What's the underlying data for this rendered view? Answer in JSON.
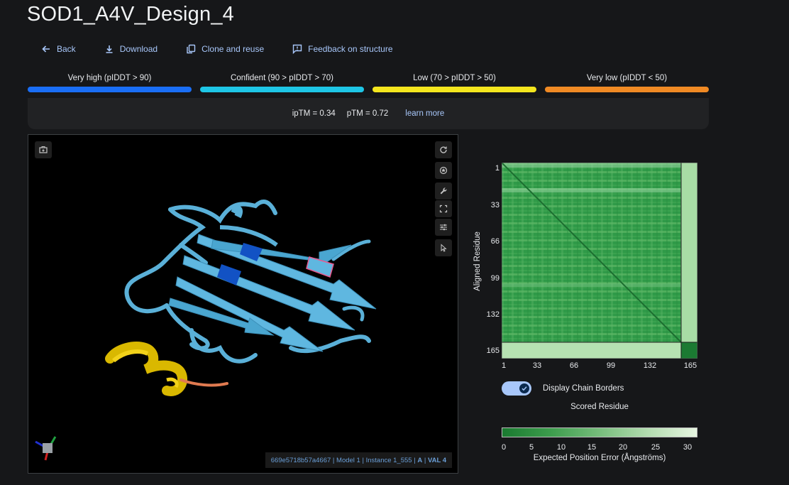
{
  "page": {
    "title": "SOD1_A4V_Design_4"
  },
  "actions": [
    {
      "label": "Back",
      "icon": "arrow-left-icon"
    },
    {
      "label": "Download",
      "icon": "download-icon"
    },
    {
      "label": "Clone and reuse",
      "icon": "copy-icon"
    },
    {
      "label": "Feedback on structure",
      "icon": "feedback-icon"
    }
  ],
  "plddt_legend": [
    {
      "label": "Very high (pIDDT > 90)",
      "color": "#1a6ef5"
    },
    {
      "label": "Confident (90 > pIDDT > 70)",
      "color": "#1ec6e6"
    },
    {
      "label": "Low (70 > pIDDT > 50)",
      "color": "#f4e61e"
    },
    {
      "label": "Very low (pIDDT < 50)",
      "color": "#f08a24"
    }
  ],
  "metrics": {
    "iptm": "ipTM = 0.34",
    "ptm": "pTM = 0.72",
    "learn_more": "learn more"
  },
  "viewer": {
    "info_id": "669e5718b57a4667",
    "info_model": "Model 1",
    "info_instance": "Instance 1_555",
    "info_chain": "A",
    "info_residue": "VAL 4",
    "tools": [
      "screenshot-icon",
      "rotate-icon",
      "highlight-icon",
      "wrench-icon",
      "fullscreen-icon",
      "settings-sliders-icon",
      "cursor-icon"
    ]
  },
  "pae": {
    "y_axis_label": "Aligned Residue",
    "x_axis_label": "Scored Residue",
    "ticks": [
      "1",
      "33",
      "66",
      "99",
      "132",
      "165"
    ],
    "toggle_label": "Display Chain Borders",
    "toggle_on": true,
    "colorbar_ticks": [
      "0",
      "5",
      "10",
      "15",
      "20",
      "25",
      "30"
    ],
    "colorbar_label": "Expected Position Error (Ångströms)"
  }
}
